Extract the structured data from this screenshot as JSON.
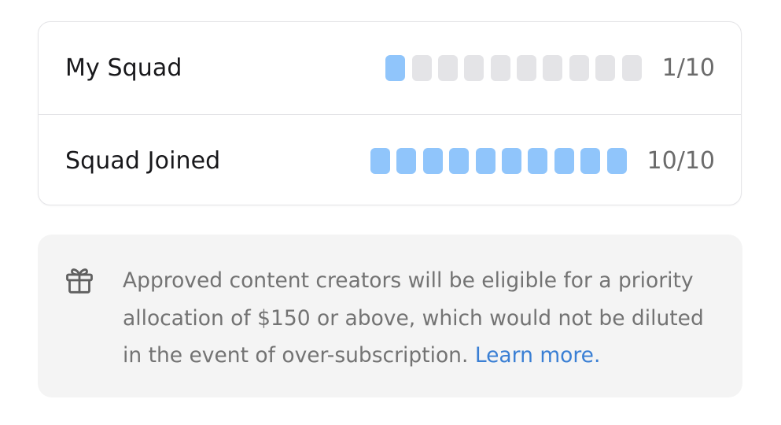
{
  "squads": [
    {
      "label": "My Squad",
      "count": "1/10",
      "filled": 1,
      "total": 10
    },
    {
      "label": "Squad Joined",
      "count": "10/10",
      "filled": 10,
      "total": 10
    }
  ],
  "notice": {
    "icon": "gift-icon",
    "text": "Approved content creators will be eligible for a priority allocation of $150 or above, which would not be diluted in the event of over-subscription.",
    "link_label": "Learn more."
  },
  "colors": {
    "segment_filled": "#90c5fb",
    "segment_empty": "#e4e4e7",
    "link": "#3a7fd4"
  }
}
